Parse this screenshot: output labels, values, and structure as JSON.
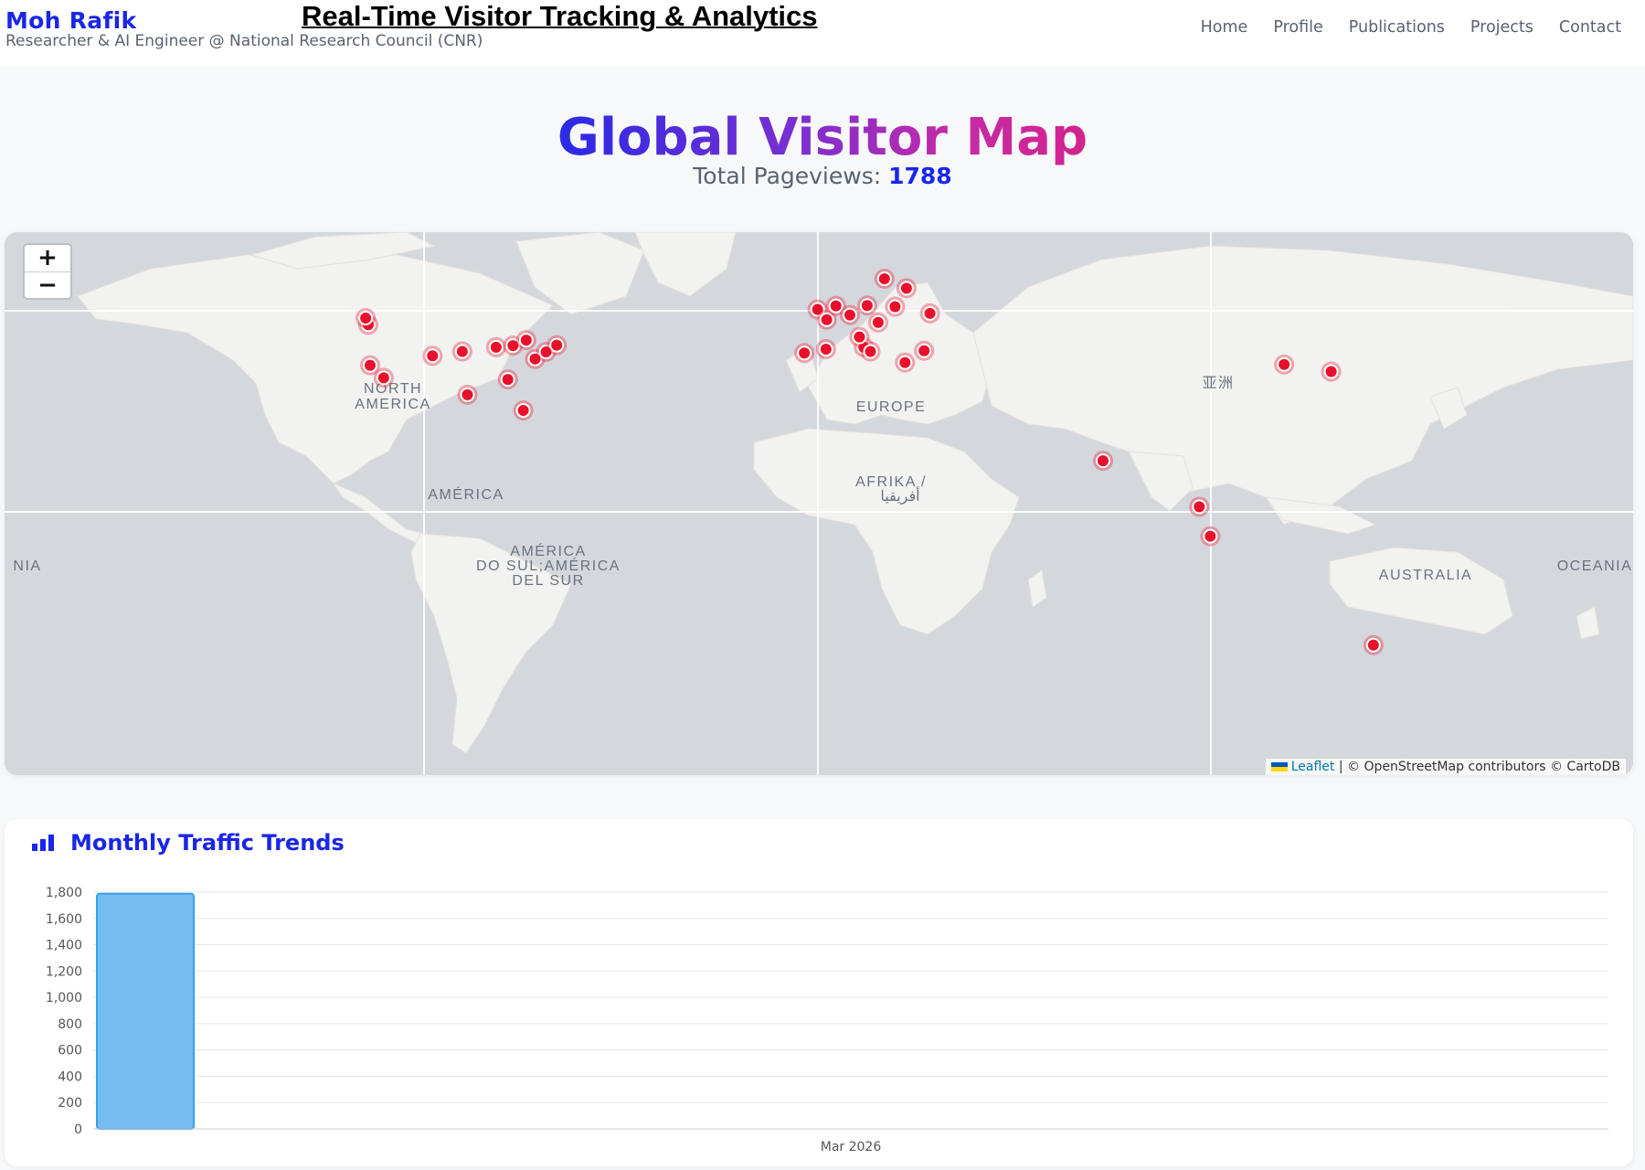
{
  "header": {
    "brand_name": "Moh Rafik",
    "brand_subtitle": "Researcher & AI Engineer @ National Research Council (CNR)",
    "page_title": "Real-Time Visitor Tracking & Analytics",
    "nav": [
      "Home",
      "Profile",
      "Publications",
      "Projects",
      "Contact"
    ]
  },
  "hero": {
    "title": "Global Visitor Map",
    "pageviews_label": "Total Pageviews:",
    "pageviews_value": "1788"
  },
  "map": {
    "zoom_in": "+",
    "zoom_out": "−",
    "labels": {
      "north_america": [
        "NORTH",
        "AMERICA"
      ],
      "america": "AMÉRICA",
      "south_america": [
        "AMÉRICA",
        "DO SUL;AMÉRICA",
        "DEL SUR"
      ],
      "europe": "EUROPE",
      "africa": [
        "AFRIKA /",
        "أفريقيا"
      ],
      "asia": "亚洲",
      "australia": "AUSTRALIA",
      "oceania": "OCEANIA",
      "oceania_left": "NIA"
    },
    "attribution_leaflet": "Leaflet",
    "attribution_rest": " | © OpenStreetMap contributors © CartoDB",
    "marker_color": "#e8102a",
    "visitor_markers": [
      {
        "lng": -122.4,
        "lat": 47.6
      },
      {
        "lng": -123.1,
        "lat": 49.3
      },
      {
        "lng": -121.9,
        "lat": 37.3
      },
      {
        "lng": -118.2,
        "lat": 34.1
      },
      {
        "lng": -104.9,
        "lat": 39.7
      },
      {
        "lng": -96.8,
        "lat": 40.8
      },
      {
        "lng": -87.6,
        "lat": 41.9
      },
      {
        "lng": -83.0,
        "lat": 42.3
      },
      {
        "lng": -79.4,
        "lat": 43.7
      },
      {
        "lng": -84.4,
        "lat": 33.7
      },
      {
        "lng": -77.0,
        "lat": 38.9
      },
      {
        "lng": -74.0,
        "lat": 40.7
      },
      {
        "lng": -80.2,
        "lat": 25.8
      },
      {
        "lng": -95.4,
        "lat": 29.8
      },
      {
        "lng": -71.1,
        "lat": 42.4
      },
      {
        "lng": -0.1,
        "lat": 51.5
      },
      {
        "lng": 2.4,
        "lat": 48.9
      },
      {
        "lng": 4.9,
        "lat": 52.4
      },
      {
        "lng": 8.7,
        "lat": 50.1
      },
      {
        "lng": 13.4,
        "lat": 52.5
      },
      {
        "lng": -3.7,
        "lat": 40.4
      },
      {
        "lng": 2.2,
        "lat": 41.4
      },
      {
        "lng": 12.5,
        "lat": 41.9
      },
      {
        "lng": 11.3,
        "lat": 44.5
      },
      {
        "lng": 16.4,
        "lat": 48.2
      },
      {
        "lng": 21.0,
        "lat": 52.2
      },
      {
        "lng": 18.1,
        "lat": 59.3
      },
      {
        "lng": 24.1,
        "lat": 56.9
      },
      {
        "lng": 30.5,
        "lat": 50.5
      },
      {
        "lng": 23.7,
        "lat": 38.0
      },
      {
        "lng": 28.9,
        "lat": 41.0
      },
      {
        "lng": 14.3,
        "lat": 40.8
      },
      {
        "lng": 77.6,
        "lat": 13.0
      },
      {
        "lng": 126.9,
        "lat": 37.5
      },
      {
        "lng": 139.7,
        "lat": 35.7
      },
      {
        "lng": 106.8,
        "lat": -6.2
      },
      {
        "lng": 103.8,
        "lat": 1.3
      },
      {
        "lng": 151.2,
        "lat": -33.9
      }
    ]
  },
  "chart_data": {
    "type": "bar",
    "title": "Monthly Traffic Trends",
    "categories": [
      "Mar 2026"
    ],
    "values": [
      1788
    ],
    "ylim": [
      0,
      1800
    ],
    "yticks": [
      0,
      200,
      400,
      600,
      800,
      1000,
      1200,
      1400,
      1600,
      1800
    ],
    "bar_color": "#75bdf0",
    "bar_border": "#36a2eb",
    "grid": true
  }
}
